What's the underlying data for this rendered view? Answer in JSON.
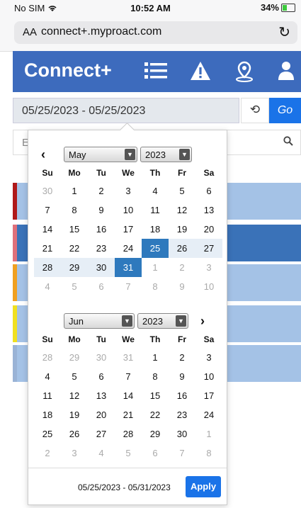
{
  "status_bar": {
    "carrier": "No SIM",
    "time": "10:52 AM",
    "battery": "34%"
  },
  "browser": {
    "text_size_label": "AA",
    "url": "connect+.myproact.com"
  },
  "navbar": {
    "brand": "Connect+"
  },
  "date_filter": {
    "value": "05/25/2023 - 05/25/2023",
    "go_label": "Go"
  },
  "search": {
    "placeholder": "E"
  },
  "calendar": {
    "weekdays": [
      "Su",
      "Mo",
      "Tu",
      "We",
      "Th",
      "Fr",
      "Sa"
    ],
    "left": {
      "month": "May",
      "year": "2023",
      "weeks": [
        [
          {
            "d": "30",
            "o": true
          },
          {
            "d": "1"
          },
          {
            "d": "2"
          },
          {
            "d": "3"
          },
          {
            "d": "4"
          },
          {
            "d": "5"
          },
          {
            "d": "6"
          }
        ],
        [
          {
            "d": "7"
          },
          {
            "d": "8"
          },
          {
            "d": "9"
          },
          {
            "d": "10"
          },
          {
            "d": "11"
          },
          {
            "d": "12"
          },
          {
            "d": "13"
          }
        ],
        [
          {
            "d": "14"
          },
          {
            "d": "15"
          },
          {
            "d": "16"
          },
          {
            "d": "17"
          },
          {
            "d": "18"
          },
          {
            "d": "19"
          },
          {
            "d": "20"
          }
        ],
        [
          {
            "d": "21"
          },
          {
            "d": "22"
          },
          {
            "d": "23"
          },
          {
            "d": "24"
          },
          {
            "d": "25",
            "a": true
          },
          {
            "d": "26",
            "r": true
          },
          {
            "d": "27",
            "r": true
          }
        ],
        [
          {
            "d": "28",
            "r": true
          },
          {
            "d": "29",
            "r": true
          },
          {
            "d": "30",
            "r": true
          },
          {
            "d": "31",
            "a": true
          },
          {
            "d": "1",
            "o": true
          },
          {
            "d": "2",
            "o": true
          },
          {
            "d": "3",
            "o": true
          }
        ],
        [
          {
            "d": "4",
            "o": true
          },
          {
            "d": "5",
            "o": true
          },
          {
            "d": "6",
            "o": true
          },
          {
            "d": "7",
            "o": true
          },
          {
            "d": "8",
            "o": true
          },
          {
            "d": "9",
            "o": true
          },
          {
            "d": "10",
            "o": true
          }
        ]
      ]
    },
    "right": {
      "month": "Jun",
      "year": "2023",
      "weeks": [
        [
          {
            "d": "28",
            "o": true
          },
          {
            "d": "29",
            "o": true
          },
          {
            "d": "30",
            "o": true
          },
          {
            "d": "31",
            "o": true
          },
          {
            "d": "1"
          },
          {
            "d": "2"
          },
          {
            "d": "3"
          }
        ],
        [
          {
            "d": "4"
          },
          {
            "d": "5"
          },
          {
            "d": "6"
          },
          {
            "d": "7"
          },
          {
            "d": "8"
          },
          {
            "d": "9"
          },
          {
            "d": "10"
          }
        ],
        [
          {
            "d": "11"
          },
          {
            "d": "12"
          },
          {
            "d": "13"
          },
          {
            "d": "14"
          },
          {
            "d": "15"
          },
          {
            "d": "16"
          },
          {
            "d": "17"
          }
        ],
        [
          {
            "d": "18"
          },
          {
            "d": "19"
          },
          {
            "d": "20"
          },
          {
            "d": "21"
          },
          {
            "d": "22"
          },
          {
            "d": "23"
          },
          {
            "d": "24"
          }
        ],
        [
          {
            "d": "25"
          },
          {
            "d": "26"
          },
          {
            "d": "27"
          },
          {
            "d": "28"
          },
          {
            "d": "29"
          },
          {
            "d": "30"
          },
          {
            "d": "1",
            "o": true
          }
        ],
        [
          {
            "d": "2",
            "o": true
          },
          {
            "d": "3",
            "o": true
          },
          {
            "d": "4",
            "o": true
          },
          {
            "d": "5",
            "o": true
          },
          {
            "d": "6",
            "o": true
          },
          {
            "d": "7",
            "o": true
          },
          {
            "d": "8",
            "o": true
          }
        ]
      ]
    },
    "selected_range": "05/25/2023 - 05/31/2023",
    "apply_label": "Apply"
  },
  "cards": [
    {
      "color": "#b01919",
      "highlight": false
    },
    {
      "color": "#e0707a",
      "highlight": true
    },
    {
      "color": "#f0a020",
      "highlight": false
    },
    {
      "color": "#f0e020",
      "highlight": false
    },
    {
      "color": "#9ab3d6",
      "highlight": false
    }
  ],
  "colors": {
    "nav": "#3d6bbd",
    "accent": "#1a73e8",
    "active_day": "#2e79bd",
    "range_day": "#e6eef6",
    "card": "#a4c2e6",
    "card_active": "#3a72b8"
  }
}
